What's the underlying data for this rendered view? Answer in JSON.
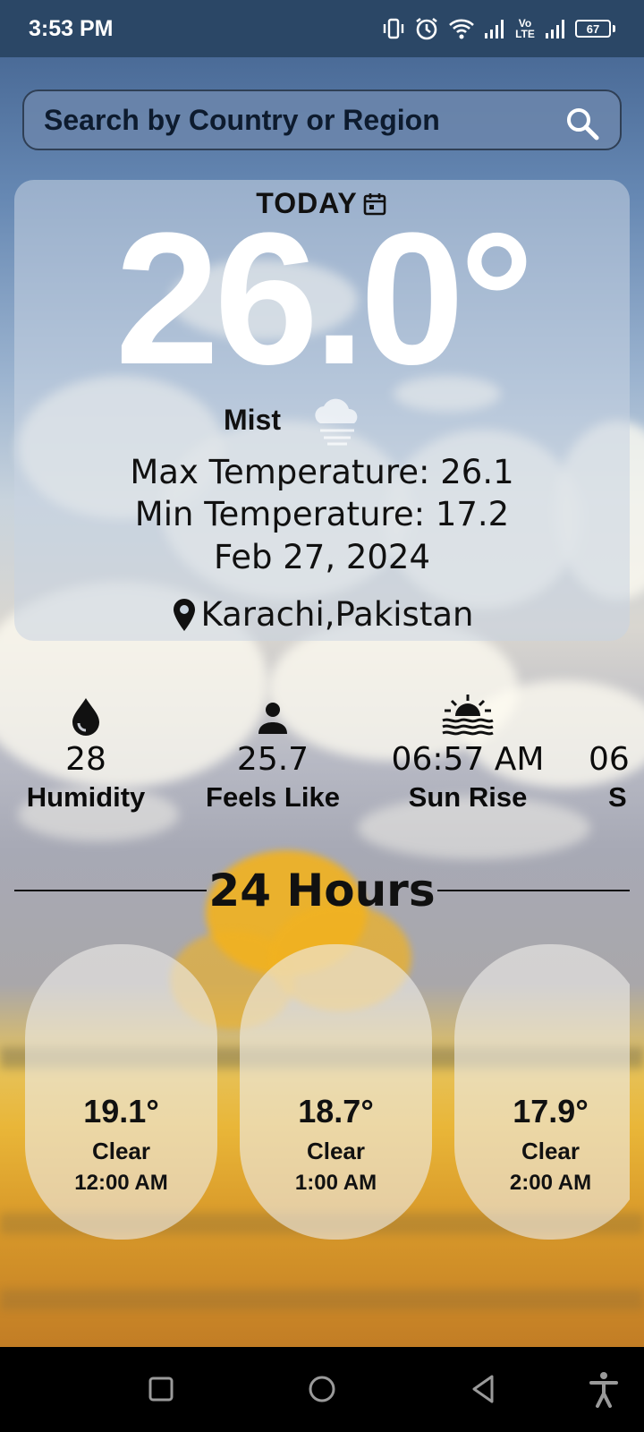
{
  "status_bar": {
    "time": "3:53 PM",
    "battery": "67",
    "network_label": "Vo LTE",
    "icons": [
      "vibrate-icon",
      "alarm-icon",
      "wifi-icon",
      "signal-icon",
      "volte-icon",
      "signal-icon",
      "battery-icon"
    ]
  },
  "search": {
    "placeholder": "Search by Country or Region",
    "icon": "search-icon"
  },
  "today": {
    "label": "TODAY",
    "temperature": "26.0°",
    "condition": "Mist",
    "max_temp": "Max Temperature: 26.1",
    "min_temp": "Min Temperature: 17.2",
    "date": "Feb 27, 2024",
    "location": "Karachi,Pakistan"
  },
  "stats": [
    {
      "icon": "water-drop-icon",
      "value": "28",
      "label": "Humidity"
    },
    {
      "icon": "person-icon",
      "value": "25.7",
      "label": "Feels Like"
    },
    {
      "icon": "sunrise-icon",
      "value": "06:57 AM",
      "label": "Sun Rise"
    },
    {
      "icon": "sunset-icon",
      "value": "06",
      "label": "S"
    }
  ],
  "hourly": {
    "title": "24 Hours",
    "items": [
      {
        "icon": "moon-icon",
        "temp": "19.1°",
        "condition": "Clear",
        "time": "12:00 AM"
      },
      {
        "icon": "moon-icon",
        "temp": "18.7°",
        "condition": "Clear",
        "time": "1:00 AM"
      },
      {
        "icon": "moon-icon",
        "temp": "17.9°",
        "condition": "Clear",
        "time": "2:00 AM"
      }
    ]
  },
  "colors": {
    "status_bar": "#2b4766",
    "accent_moon": "#1a5fd1"
  }
}
